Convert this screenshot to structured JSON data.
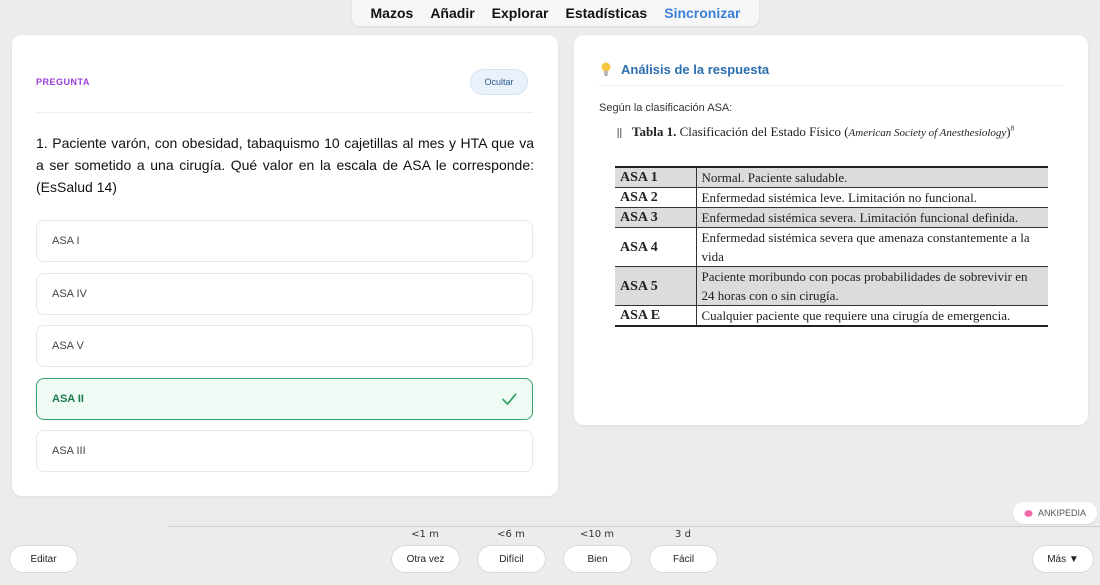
{
  "nav": {
    "tabs": [
      "Mazos",
      "Añadir",
      "Explorar",
      "Estadísticas",
      "Sincronizar"
    ],
    "active_index": 4
  },
  "question": {
    "label": "PREGUNTA",
    "hide_label": "Ocultar",
    "text": "1. Paciente varón, con obesidad, tabaquismo 10 cajetillas al mes y HTA que va a ser sometido a una cirugía. Qué valor en la escala de ASA le corresponde: (EsSalud 14)",
    "options": [
      {
        "label": "ASA I",
        "correct": false
      },
      {
        "label": "ASA IV",
        "correct": false
      },
      {
        "label": "ASA V",
        "correct": false
      },
      {
        "label": "ASA II",
        "correct": true
      },
      {
        "label": "ASA III",
        "correct": false
      }
    ]
  },
  "analysis": {
    "title": "Análisis de la respuesta",
    "intro": "Según la clasificación ASA:",
    "caption_bold": "Tabla 1.",
    "caption_text": "Clasificación del Estado Físico (",
    "caption_italic": "American Society of Anesthesiology",
    "caption_end": ")",
    "caption_sup": "8",
    "table": [
      {
        "key": "ASA 1",
        "value": "Normal. Paciente saludable."
      },
      {
        "key": "ASA 2",
        "value": "Enfermedad sistémica leve. Limitación no funcional."
      },
      {
        "key": "ASA 3",
        "value": "Enfermedad sistémica severa. Limitación funcional definida."
      },
      {
        "key": "ASA 4",
        "value": "Enfermedad sistémica severa que amenaza constantemente a la vida"
      },
      {
        "key": "ASA 5",
        "value": "Paciente moribundo con pocas probabilidades de sobrevivir en 24 horas con o sin cirugía."
      },
      {
        "key": "ASA E",
        "value": "Cualquier paciente que requiere una cirugía de emergencia."
      }
    ]
  },
  "badge": {
    "label": "ANKIPEDIA"
  },
  "bottom": {
    "edit_label": "Editar",
    "more_label": "Más ▼",
    "ease": [
      {
        "interval": "<1 m",
        "label": "Otra vez"
      },
      {
        "interval": "<6 m",
        "label": "Difícil"
      },
      {
        "interval": "<10 m",
        "label": "Bien"
      },
      {
        "interval": "3 d",
        "label": "Fácil"
      }
    ]
  },
  "colors": {
    "accent": "#3a7fd6",
    "correct": "#36a46a",
    "question_label": "#9b3fd6",
    "analysis_title": "#2a6fad"
  }
}
